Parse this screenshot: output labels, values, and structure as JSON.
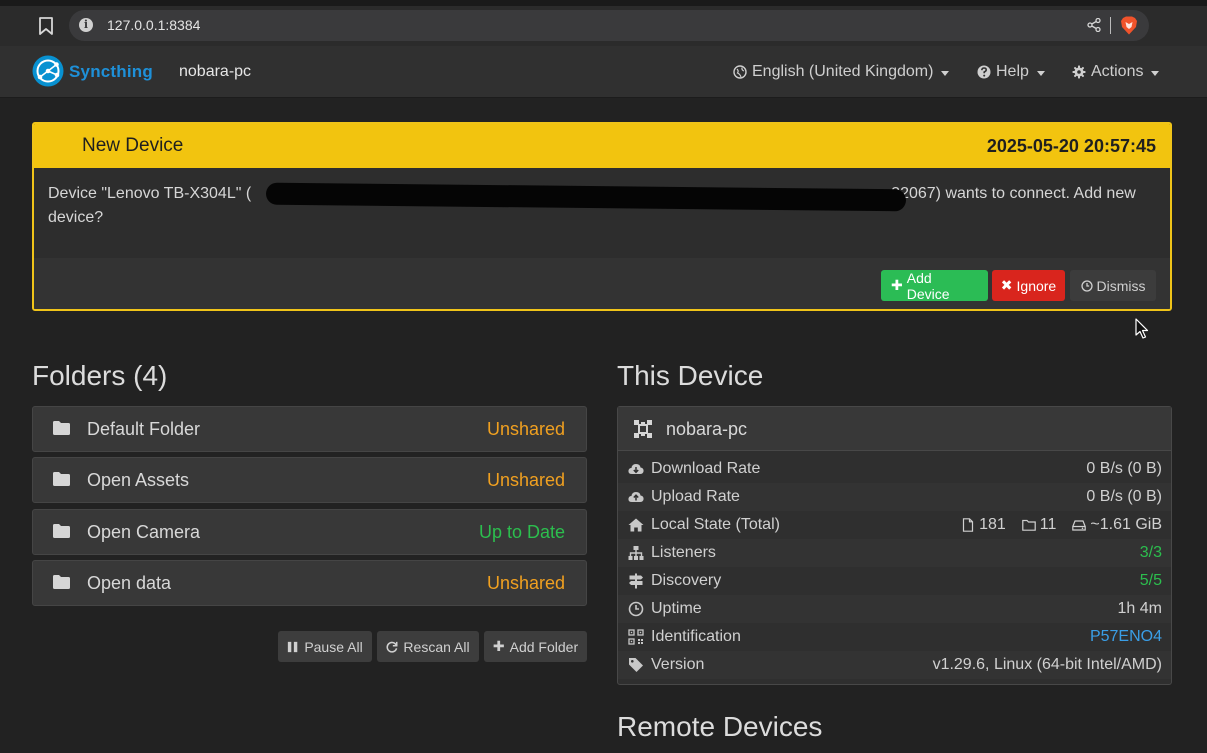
{
  "browser": {
    "url": "127.0.0.1:8384",
    "info_glyph": "i"
  },
  "navbar": {
    "brand": "Syncthing",
    "device_name": "nobara-pc",
    "language": "English (United Kingdom)",
    "help": "Help",
    "actions": "Actions"
  },
  "notification": {
    "title": "New Device",
    "timestamp": "2025-05-20 20:57:45",
    "message_prefix": "Device \"Lenovo TB-X304L\" (",
    "message_suffix": "22067) wants to connect. Add new device?",
    "buttons": {
      "add": "Add Device",
      "ignore": "Ignore",
      "dismiss": "Dismiss"
    }
  },
  "folders": {
    "heading": "Folders (4)",
    "items": [
      {
        "name": "Default Folder",
        "status": "Unshared"
      },
      {
        "name": "Open Assets",
        "status": "Unshared"
      },
      {
        "name": "Open Camera",
        "status": "Up to Date"
      },
      {
        "name": "Open data",
        "status": "Unshared"
      }
    ],
    "buttons": {
      "pause_all": "Pause All",
      "rescan_all": "Rescan All",
      "add_folder": "Add Folder"
    }
  },
  "this_device": {
    "heading": "This Device",
    "name": "nobara-pc",
    "rows": {
      "download": {
        "label": "Download Rate",
        "value": "0 B/s (0 B)"
      },
      "upload": {
        "label": "Upload Rate",
        "value": "0 B/s (0 B)"
      },
      "local_state": {
        "label": "Local State (Total)",
        "files": "181",
        "dirs": "11",
        "size": "~1.61 GiB"
      },
      "listeners": {
        "label": "Listeners",
        "value": "3/3"
      },
      "discovery": {
        "label": "Discovery",
        "value": "5/5"
      },
      "uptime": {
        "label": "Uptime",
        "value": "1h 4m"
      },
      "identification": {
        "label": "Identification",
        "value": "P57ENO4"
      },
      "version": {
        "label": "Version",
        "value": "v1.29.6, Linux (64-bit Intel/AMD)"
      }
    }
  },
  "remote_devices": {
    "heading": "Remote Devices"
  },
  "colors": {
    "accent_brand": "#1e90d8",
    "warning": "#f2c40f",
    "success": "#2bbc55",
    "danger": "#d9251d",
    "unshared": "#f0a020"
  },
  "icons": {
    "bookmark": "bookmark-icon",
    "share": "share-icon",
    "brave": "brave-lion-icon",
    "globe": "globe-icon",
    "help": "question-circle-icon",
    "actions": "gear-icon",
    "folder": "folder-icon",
    "device": "qrcode-device-icon",
    "download": "cloud-download-icon",
    "upload": "cloud-upload-icon",
    "home": "home-icon",
    "sitemap": "sitemap-icon",
    "signpost": "signpost-icon",
    "clock": "clock-icon",
    "qrcode": "qrcode-icon",
    "tag": "tag-icon"
  }
}
